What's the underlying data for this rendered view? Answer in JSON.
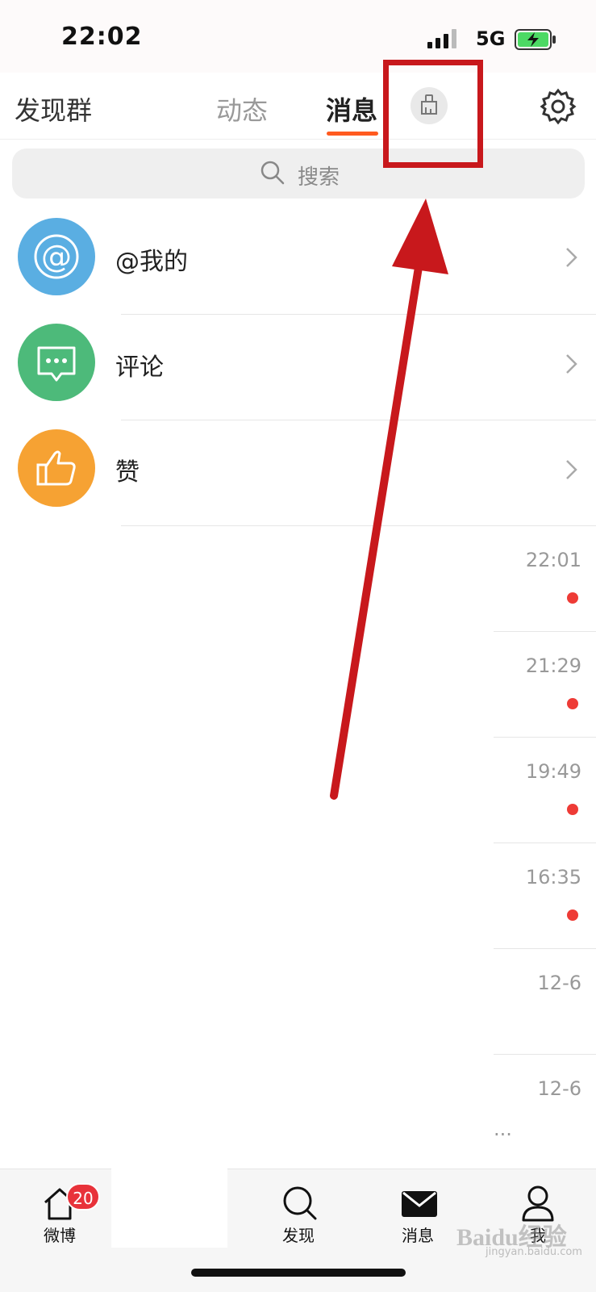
{
  "status_bar": {
    "time": "22:02",
    "network": "5G"
  },
  "header": {
    "discover_group": "发现群",
    "tabs": [
      {
        "label": "动态"
      },
      {
        "label": "消息"
      }
    ],
    "active_tab": "消息"
  },
  "search": {
    "placeholder": "搜索"
  },
  "menu": [
    {
      "label": "@我的",
      "icon": "at-icon",
      "color": "#5aaee2"
    },
    {
      "label": "评论",
      "icon": "comment-icon",
      "color": "#4dba7a"
    },
    {
      "label": "赞",
      "icon": "thumbs-up-icon",
      "color": "#f6a233"
    }
  ],
  "conversations": [
    {
      "time": "22:01",
      "unread": true
    },
    {
      "time": "21:29",
      "unread": true
    },
    {
      "time": "19:49",
      "unread": true
    },
    {
      "time": "16:35",
      "unread": true
    },
    {
      "time": "12-6",
      "unread": false
    },
    {
      "time": "12-6",
      "unread": false,
      "preview": "..."
    }
  ],
  "bottom_nav": {
    "items": [
      {
        "label": "微博",
        "icon": "home-icon",
        "badge": "20"
      },
      {
        "label": "发现",
        "icon": "search-icon"
      },
      {
        "label": "消息",
        "icon": "mail-icon"
      },
      {
        "label": "我",
        "icon": "profile-icon"
      }
    ]
  },
  "annotation": {
    "highlight_color": "#c8181c"
  },
  "watermark": {
    "brand": "Baidu经验",
    "url": "jingyan.baidu.com"
  },
  "colors": {
    "accent": "#ff5a1f",
    "unread_dot": "#ee3b36",
    "badge": "#e8323a"
  }
}
